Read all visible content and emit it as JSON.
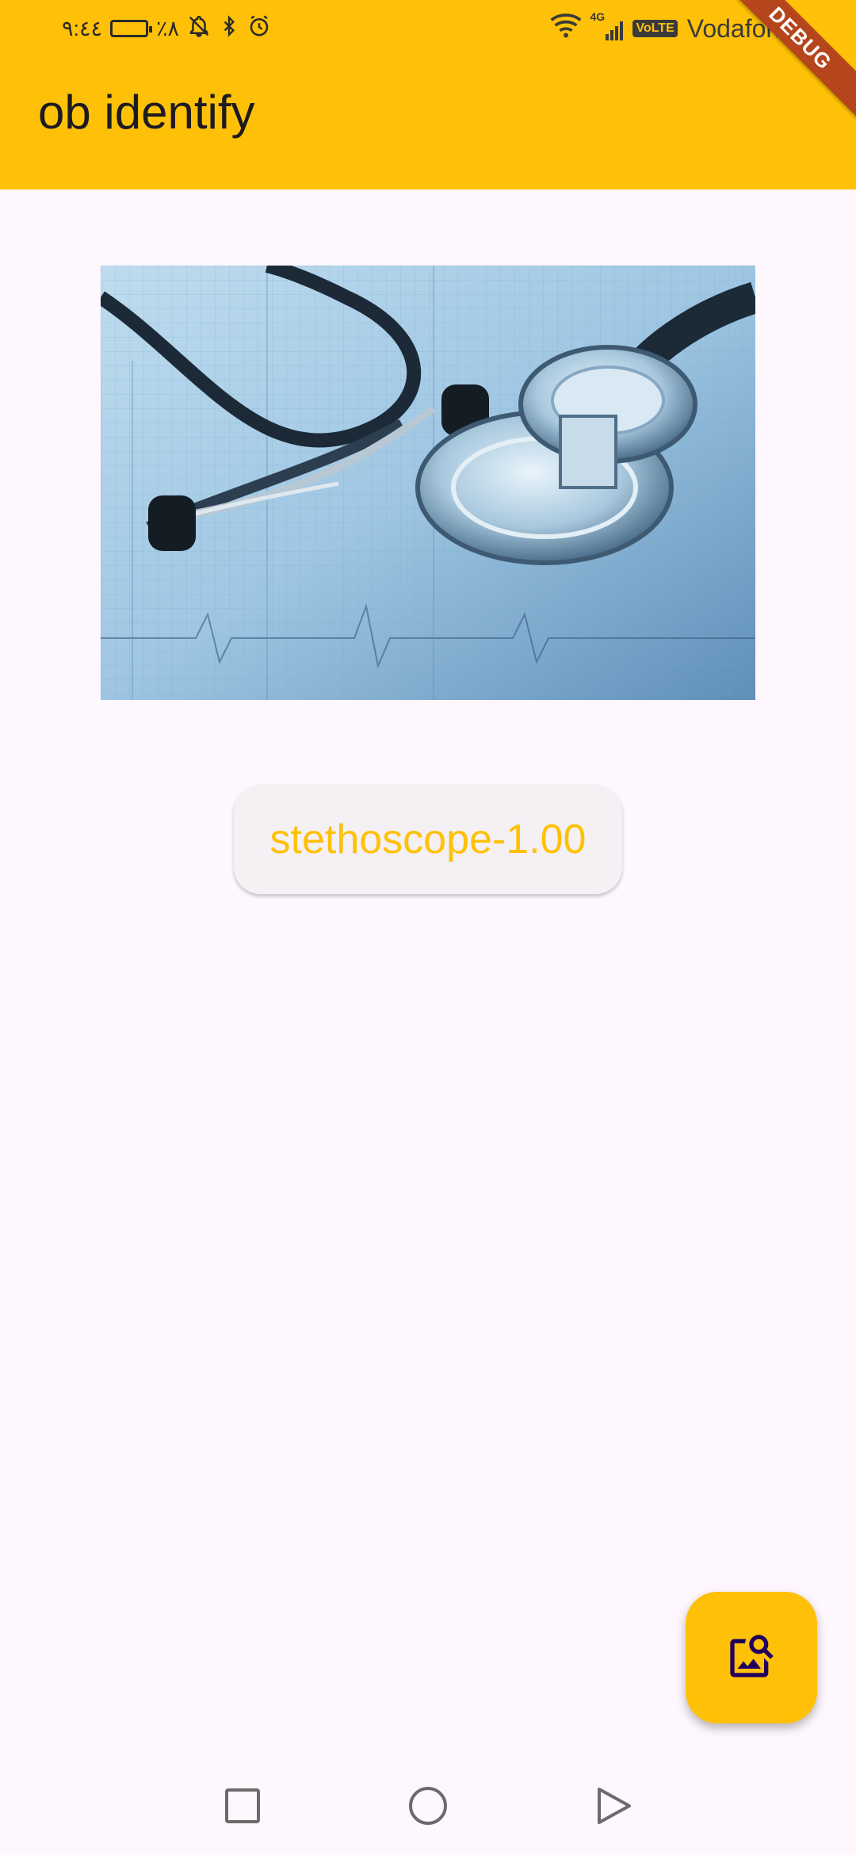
{
  "status_bar": {
    "time": "٩:٤٤",
    "battery_percent": "٪٨",
    "carrier": "Vodafone",
    "network": "4G",
    "volte": "VoLTE"
  },
  "app_bar": {
    "title": "ob identify",
    "background_color": "#ffc107",
    "debug_banner": "DEBUG"
  },
  "content": {
    "image": {
      "icon": "stethoscope-photo"
    },
    "result_label": "stethoscope-1.00"
  },
  "fab": {
    "icon": "image-search-icon"
  },
  "nav_bar": {
    "buttons": [
      "recents-icon",
      "home-icon",
      "back-icon"
    ]
  }
}
